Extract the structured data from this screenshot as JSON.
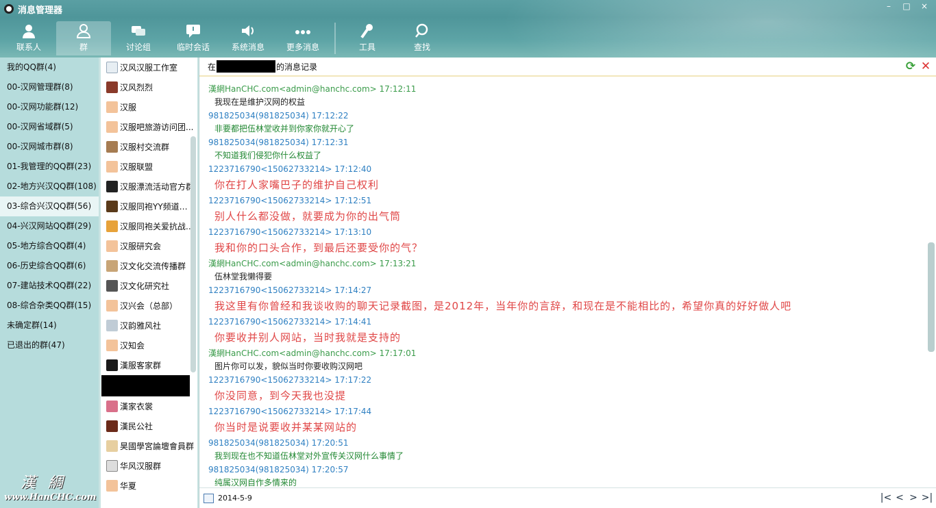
{
  "window": {
    "title": "消息管理器",
    "controls": [
      "–",
      "□",
      "×"
    ]
  },
  "tabs": [
    {
      "label": "联系人",
      "icon": "person-icon"
    },
    {
      "label": "群",
      "icon": "group-icon"
    },
    {
      "label": "讨论组",
      "icon": "chat-bubbles-icon"
    },
    {
      "label": "临时会话",
      "icon": "temp-chat-icon"
    },
    {
      "label": "系统消息",
      "icon": "speaker-icon"
    },
    {
      "label": "更多消息",
      "icon": "more-dots-icon"
    },
    {
      "label": "工具",
      "icon": "wrench-icon"
    },
    {
      "label": "查找",
      "icon": "search-icon"
    }
  ],
  "categories": [
    "我的QQ群(4)",
    "00-汉网管理群(8)",
    "00-汉网功能群(12)",
    "00-汉网省域群(5)",
    "00-汉网城市群(8)",
    "01-我管理的QQ群(23)",
    "02-地方兴汉QQ群(108)",
    "03-综合兴汉QQ群(56)",
    "04-兴汉网站QQ群(29)",
    "05-地方综合QQ群(4)",
    "06-历史综合QQ群(6)",
    "07-建站技术QQ群(22)",
    "08-综合杂类QQ群(15)",
    "未确定群(14)",
    "已退出的群(47)"
  ],
  "brand": {
    "big": "漢綢",
    "url": "www.HanCHC.com"
  },
  "groups": [
    "汉风汉服工作室",
    "汉风烈烈",
    "汉服",
    "汉服吧旅游访问团...",
    "汉服村交流群",
    "汉服联盟",
    "汉服漂流活动官方群",
    "汉服同袍YY频道招...",
    "汉服同袍关爱抗战...",
    "汉服研究会",
    "汉文化交流传播群",
    "汉文化研究社",
    "汉兴会（总部）",
    "汉韵雅风社",
    "汉知会",
    "漢服客家群",
    "",
    "漢家衣裳",
    "漢民公社",
    "昊國學宮論壇會員群",
    "华风汉服群",
    "华夏"
  ],
  "messages_header": {
    "prefix": "在",
    "suffix": "的消息记录"
  },
  "messages": [
    {
      "meta": "漢網HanCHC.com<admin@hanchc.com> 17:12:11",
      "meta_color": "green",
      "text": "我现在是维护汉网的权益",
      "style": "dark"
    },
    {
      "meta": "981825034(981825034) 17:12:22",
      "meta_color": "blue",
      "text": "非要都把伍林堂收并到你家你就开心了",
      "style": "green"
    },
    {
      "meta": "981825034(981825034) 17:12:31",
      "meta_color": "blue",
      "text": "不知道我们侵犯你什么权益了",
      "style": "green"
    },
    {
      "meta": "1223716790<15062733214> 17:12:40",
      "meta_color": "blue",
      "text": "你在打人家嘴巴子的维护自己权利",
      "style": "big"
    },
    {
      "meta": "1223716790<15062733214> 17:12:51",
      "meta_color": "blue",
      "text": "别人什么都没做，就要成为你的出气筒",
      "style": "big"
    },
    {
      "meta": "1223716790<15062733214> 17:13:10",
      "meta_color": "blue",
      "text": "我和你的口头合作，到最后还要受你的气？",
      "style": "big"
    },
    {
      "meta": "漢網HanCHC.com<admin@hanchc.com> 17:13:21",
      "meta_color": "green",
      "text": "伍林堂我懒得要",
      "style": "dark"
    },
    {
      "meta": "1223716790<15062733214> 17:14:27",
      "meta_color": "blue",
      "text": "我这里有你曾经和我谈收购的聊天记录截图，是2012年，当年你的言辞，和现在是不能相比的，希望你真的好好做人吧",
      "style": "big"
    },
    {
      "meta": "1223716790<15062733214> 17:14:41",
      "meta_color": "blue",
      "text": "你要收并别人网站，当时我就是支持的",
      "style": "big"
    },
    {
      "meta": "漢網HanCHC.com<admin@hanchc.com> 17:17:01",
      "meta_color": "green",
      "text": "图片你可以发，貌似当时你要收购汉网吧",
      "style": "dark"
    },
    {
      "meta": "1223716790<15062733214> 17:17:22",
      "meta_color": "blue",
      "text": "你没同意，到今天我也没提",
      "style": "big"
    },
    {
      "meta": "1223716790<15062733214> 17:17:44",
      "meta_color": "blue",
      "text": "你当时是说要收并某某网站的",
      "style": "big"
    },
    {
      "meta": "981825034(981825034) 17:20:51",
      "meta_color": "blue",
      "text": "我到现在也不知道伍林堂对外宣传关汉网什么事情了",
      "style": "green"
    },
    {
      "meta": "981825034(981825034) 17:20:57",
      "meta_color": "blue",
      "text": "纯属汉网自作多情来的",
      "style": "green"
    }
  ],
  "footer": {
    "date": "2014-5-9",
    "pager": [
      "|<",
      "<",
      ">",
      ">|"
    ]
  },
  "colors": {
    "accent": "#4f969a",
    "meta_blue": "#2f80c2",
    "meta_green": "#3a9b4a",
    "msg_red": "#e04646",
    "msg_green": "#228833"
  }
}
